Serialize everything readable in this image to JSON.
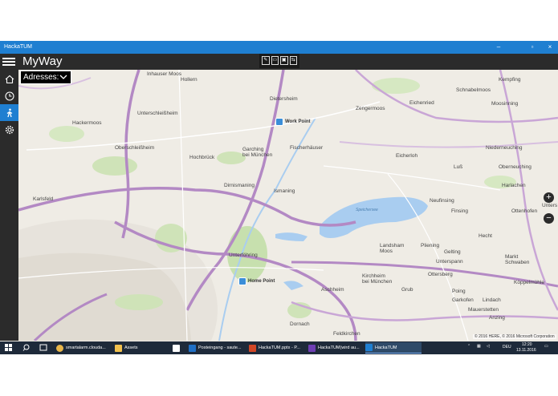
{
  "window": {
    "title": "HackaTUM"
  },
  "app": {
    "title": "MyWay"
  },
  "dropdown": {
    "label": "Adresses:"
  },
  "ink_toolbar": [
    "✎",
    "▭",
    "▣",
    "⇆"
  ],
  "sidebar": {
    "items": [
      {
        "icon": "home-icon"
      },
      {
        "icon": "clock-icon"
      },
      {
        "icon": "walking-person-icon",
        "active": true
      },
      {
        "icon": "gear-icon"
      }
    ]
  },
  "map": {
    "pins": [
      {
        "label": "Work Point"
      },
      {
        "label": "Home Point"
      }
    ],
    "places": {
      "inhauser_moos": "Inhauser Moos",
      "hollern": "Hollern",
      "dietersheim": "Dietersheim",
      "zengermoos": "Zengermoos",
      "eichenried": "Eichenried",
      "schnabelmoos": "Schnabelmoos",
      "kempfing": "Kempfing",
      "moosinning": "Moosinning",
      "hackermoos": "Hackermoos",
      "unterschleissheim": "Unterschleißheim",
      "oberschleissheim": "Oberschleißheim",
      "garching": "Garching\nbei München",
      "fischerhaeuser": "Fischerhäuser",
      "eicherloh": "Eicherloh",
      "niederneuching": "Niederneuching",
      "hochbrueck": "Hochbrück",
      "lussl": "Luß",
      "oberneuching": "Oberneuching",
      "karlsfeld": "Karlsfeld",
      "dirnismaning": "Dirnismaning",
      "ismaning": "Ismaning",
      "neufinsing": "Neufinsing",
      "harlachen": "Harlachen",
      "finsing": "Finsing",
      "ottenhofen": "Ottenhofen",
      "unterfoehring": "Unterföhring",
      "landsham_moos": "Landsham\nMoos",
      "pliening": "Pliening",
      "hecht": "Hecht",
      "gelting": "Gelting",
      "markt_schwaben": "Markt\nSchwaben",
      "unterspann": "Unterspann",
      "kirchheim": "Kirchheim\nbei München",
      "koeppelmuehle": "Köppelmühle",
      "aschheim": "Aschheim",
      "grub": "Grub",
      "ottersberg": "Ottersberg",
      "poing": "Poing",
      "garkofen": "Garkofen",
      "lindach": "Lindach",
      "dornach": "Dornach",
      "feldkirchen": "Feldkirchen",
      "mauerstetten": "Mauerstetten",
      "anzing": "Anzing",
      "unterstand": "Unters",
      "speichersee": "Speichersee"
    },
    "copyright": "© 2016 HERE, © 2016 Microsoft Corporation",
    "zoom_in": "+",
    "zoom_out": "−"
  },
  "taskbar": {
    "items": [
      {
        "label": "smartalarm.clouda...",
        "color": "#e8b64a"
      },
      {
        "label": "Assets",
        "color": "#f2c14e"
      },
      {
        "label": "",
        "color": "#3a78d4"
      },
      {
        "label": "Posteingang - saute...",
        "color": "#1f6fc5"
      },
      {
        "label": "HackaTUM.pptx - P...",
        "color": "#d24726"
      },
      {
        "label": "HackaTUM(wird au...",
        "color": "#6e3eb4"
      },
      {
        "label": "HackaTUM",
        "color": "#1f7fd1",
        "active": true
      }
    ],
    "language": "DEU",
    "time": "12:20",
    "date": "13.11.2016"
  }
}
